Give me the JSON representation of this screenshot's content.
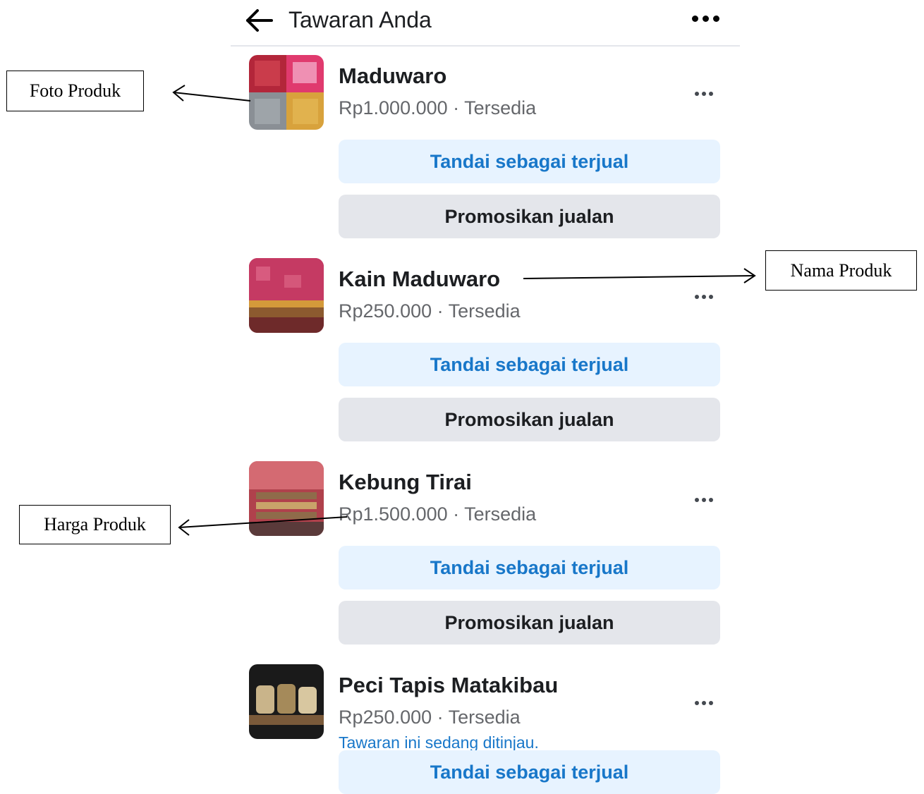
{
  "header": {
    "title": "Tawaran Anda",
    "back_icon": "arrow-left-icon",
    "more_icon": "more-horizontal-icon"
  },
  "items": [
    {
      "name": "Maduwaro",
      "meta": "Rp1.000.000 · Tersedia",
      "note": "",
      "thumb_colors": [
        "#b3263a",
        "#e03a6e",
        "#8a8f95",
        "#d8a23c"
      ],
      "sold_label": "Tandai sebagai terjual",
      "promo_label": "Promosikan jualan"
    },
    {
      "name": "Kain Maduwaro",
      "meta": "Rp250.000 · Tersedia",
      "note": "",
      "thumb_colors": [
        "#a3234b",
        "#c53a63",
        "#8c5a2f",
        "#6e2a2a"
      ],
      "sold_label": "Tandai sebagai terjual",
      "promo_label": "Promosikan jualan"
    },
    {
      "name": "Kebung Tirai",
      "meta": "Rp1.500.000 · Tersedia",
      "note": "",
      "thumb_colors": [
        "#b0414c",
        "#d46a72",
        "#8f6b4a",
        "#5a3a3a"
      ],
      "sold_label": "Tandai sebagai terjual",
      "promo_label": "Promosikan jualan"
    },
    {
      "name": "Peci Tapis Matakibau",
      "meta": "Rp250.000 · Tersedia",
      "note": "Tawaran ini sedang ditinjau.",
      "thumb_colors": [
        "#1a1a1a",
        "#c9b48a",
        "#7a5a3a",
        "#2a2a2a"
      ],
      "sold_label": "Tandai sebagai terjual",
      "promo_label": ""
    }
  ],
  "annotations": {
    "foto": "Foto Produk",
    "nama": "Nama Produk",
    "harga": "Harga Produk"
  },
  "colors": {
    "accent_blue": "#1877c9",
    "sold_button_bg": "#e7f3ff",
    "promo_button_bg": "#e4e6eb",
    "secondary_text": "#65676b"
  }
}
